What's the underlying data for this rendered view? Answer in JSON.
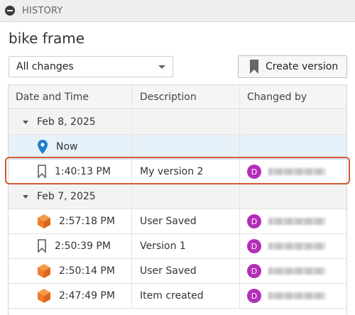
{
  "panel": {
    "title": "HISTORY"
  },
  "document": {
    "title": "bike frame"
  },
  "filter": {
    "selected": "All changes"
  },
  "toolbar": {
    "create_version_label": "Create version"
  },
  "table": {
    "headers": [
      "Date and Time",
      "Description",
      "Changed by"
    ],
    "groups": [
      {
        "date": "Feb 8, 2025",
        "rows": [
          {
            "time": "Now",
            "description": "",
            "avatar": "",
            "icon": "location-pin-icon",
            "is_now": true
          },
          {
            "time": "1:40:13 PM",
            "description": "My version 2",
            "avatar": "D",
            "icon": "bookmark-icon",
            "highlighted": true
          }
        ]
      },
      {
        "date": "Feb 7, 2025",
        "rows": [
          {
            "time": "2:57:18 PM",
            "description": "User Saved",
            "avatar": "D",
            "icon": "cube-icon"
          },
          {
            "time": "2:50:39 PM",
            "description": "Version 1",
            "avatar": "D",
            "icon": "bookmark-icon"
          },
          {
            "time": "2:50:14 PM",
            "description": "User Saved",
            "avatar": "D",
            "icon": "cube-icon"
          },
          {
            "time": "2:47:49 PM",
            "description": "Item created",
            "avatar": "D",
            "icon": "cube-icon"
          }
        ]
      }
    ]
  },
  "colors": {
    "avatar": "#b32eb8",
    "highlight": "#d45834",
    "now_row": "#e7f1fa",
    "pin": "#1f7fd1",
    "cube": "#ef7d2a"
  }
}
